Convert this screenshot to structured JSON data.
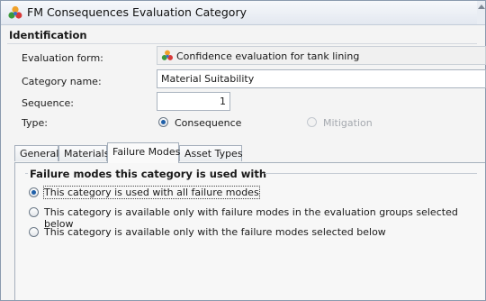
{
  "window": {
    "title": "FM Consequences Evaluation Category",
    "icon": "colored-molecules-icon"
  },
  "identification": {
    "heading": "Identification",
    "evaluation_form_label": "Evaluation form:",
    "evaluation_form_value": "Confidence evaluation for tank lining",
    "category_name_label": "Category name:",
    "category_name_value": "Material Suitability",
    "sequence_label": "Sequence:",
    "sequence_value": "1",
    "type_label": "Type:",
    "type_options": [
      {
        "label": "Consequence",
        "selected": true,
        "enabled": true
      },
      {
        "label": "Mitigation",
        "selected": false,
        "enabled": false
      }
    ]
  },
  "tabs": [
    {
      "label": "General",
      "active": false
    },
    {
      "label": "Materials",
      "active": false
    },
    {
      "label": "Failure Modes",
      "active": true
    },
    {
      "label": "Asset Types",
      "active": false
    }
  ],
  "failure_modes": {
    "group_title": "Failure modes this category is used with",
    "options": [
      {
        "label": "This category is used with all failure modes",
        "selected": true
      },
      {
        "label": "This category is available only with failure modes in the evaluation groups selected below",
        "selected": false
      },
      {
        "label": "This category is available only with the failure modes selected below",
        "selected": false
      }
    ]
  },
  "colors": {
    "accent": "#1f5fa8",
    "title_bar": "#e3e8f0",
    "border": "#a9b3bf"
  }
}
